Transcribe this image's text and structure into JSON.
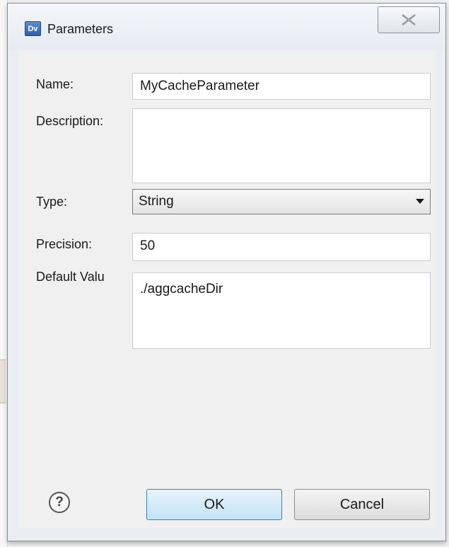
{
  "dialog": {
    "title": "Parameters",
    "app_icon_text": "Dv",
    "close_icon": "close-icon"
  },
  "form": {
    "name_label": "Name:",
    "name_value": "MyCacheParameter",
    "description_label": "Description:",
    "description_value": "",
    "type_label": "Type:",
    "type_value": "String",
    "precision_label": "Precision:",
    "precision_value": "50",
    "default_label": "Default Valu",
    "default_value": "./aggcacheDir"
  },
  "footer": {
    "help_icon": "help-icon",
    "help_glyph": "?",
    "ok_label": "OK",
    "cancel_label": "Cancel"
  }
}
